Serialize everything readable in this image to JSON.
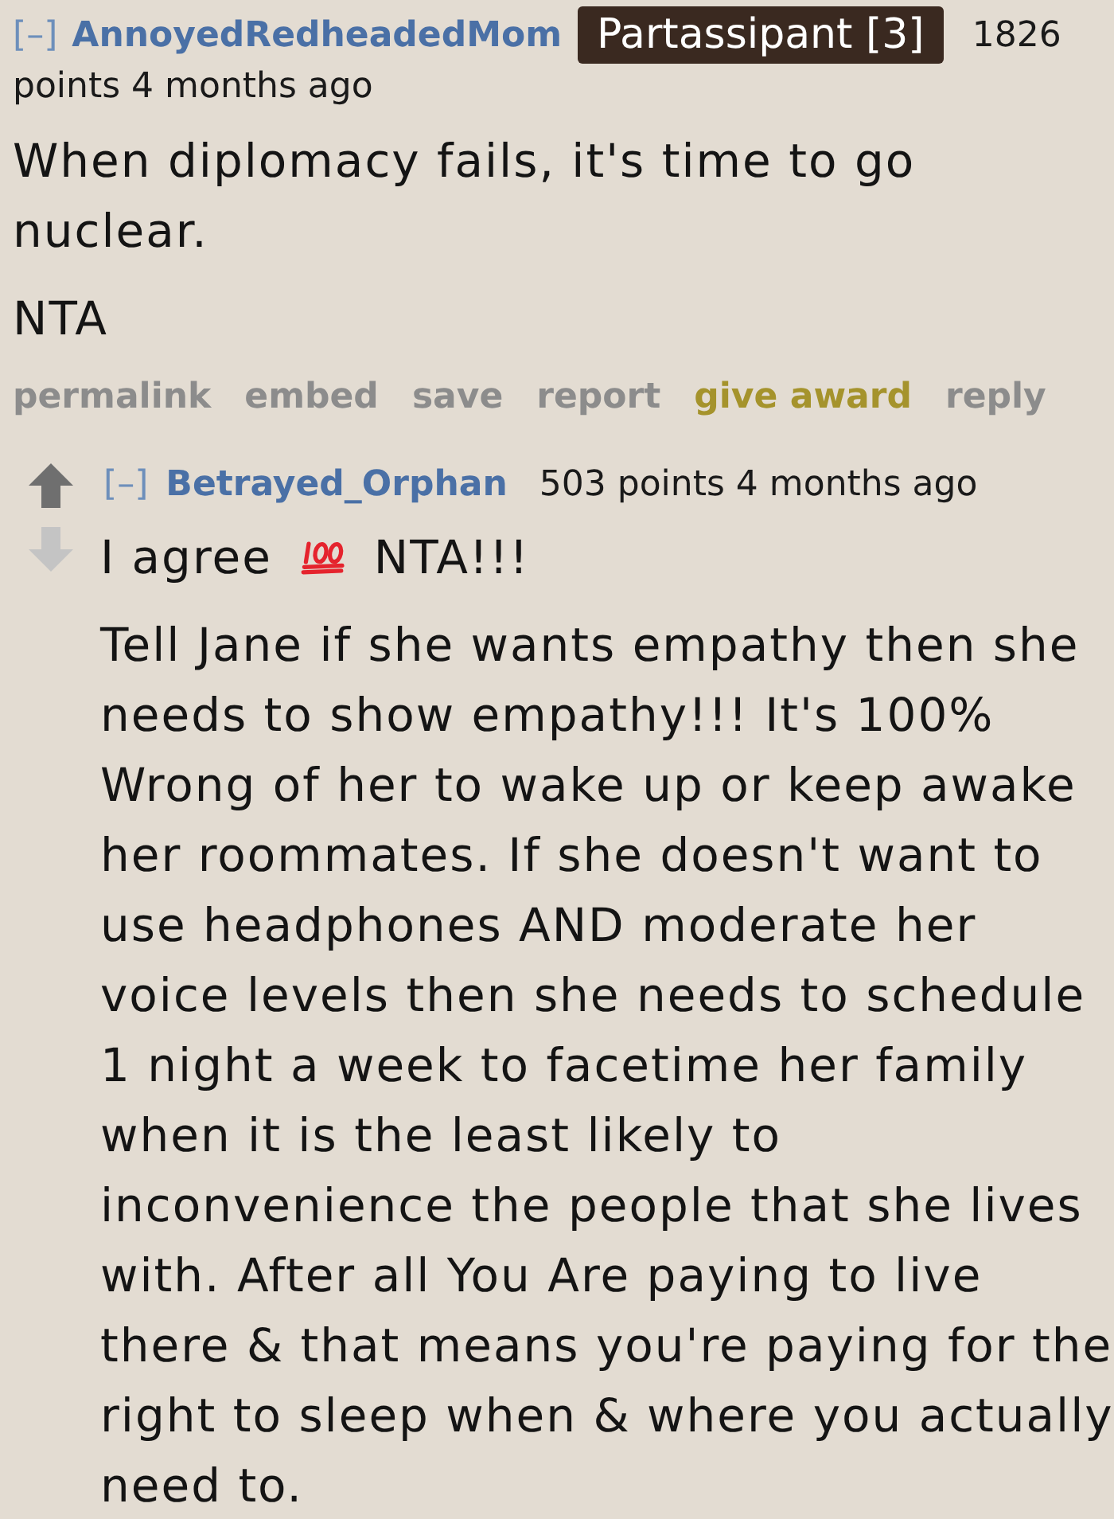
{
  "comments": [
    {
      "collapse": "[–]",
      "author": "AnnoyedRedheadedMom",
      "flair": "Partassipant [3]",
      "meta": [
        "1826",
        "points 4 months ago"
      ],
      "paragraphs": [
        {
          "segments": [
            {
              "kind": "text",
              "text": "When diplomacy fails, it's time to go nuclear."
            }
          ]
        },
        {
          "segments": [
            {
              "kind": "text",
              "text": "NTA"
            }
          ]
        }
      ],
      "actions": [
        {
          "kind": "link",
          "label": "permalink"
        },
        {
          "kind": "link",
          "label": "embed"
        },
        {
          "kind": "link",
          "label": "save"
        },
        {
          "kind": "link",
          "label": "report"
        },
        {
          "kind": "award",
          "label": "give award"
        },
        {
          "kind": "link",
          "label": "reply"
        }
      ],
      "replies": [
        {
          "collapse": "[–]",
          "author": "Betrayed_Orphan",
          "meta": [
            "503 points 4 months ago"
          ],
          "paragraphs": [
            {
              "segments": [
                {
                  "kind": "text",
                  "text": "I agree"
                },
                {
                  "kind": "emoji"
                },
                {
                  "kind": "text",
                  "text": "NTA!!!"
                }
              ]
            },
            {
              "segments": [
                {
                  "kind": "text",
                  "text": "Tell Jane if she wants empathy then she needs to show empathy!!! It's 100% Wrong of her to wake up or keep awake her roommates. If she doesn't want to use headphones AND moderate her voice levels then she needs to schedule 1 night a week to facetime her family when it is the least likely to inconvenience the people that she lives with. After all You Are paying to live there & that means you're paying for the right to sleep when & where you actually need to."
                }
              ]
            }
          ]
        }
      ]
    }
  ]
}
